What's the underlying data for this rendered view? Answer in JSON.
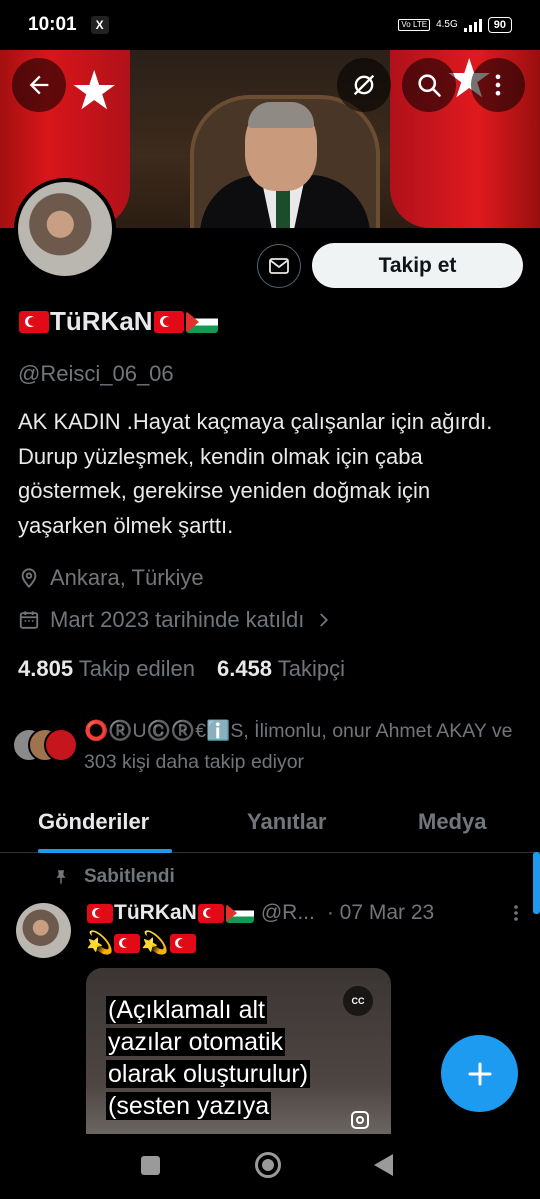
{
  "status_bar": {
    "time": "10:01",
    "notification": "X",
    "volte": "Vo LTE",
    "network": "4.5G",
    "battery": "90"
  },
  "header": {
    "back_icon": "arrow-left-icon",
    "hide_icon": "eye-slash-icon",
    "search_icon": "search-icon",
    "more_icon": "more-vertical-icon"
  },
  "profile": {
    "display_name": "TüRKaN",
    "handle": "@Reisci_06_06",
    "bio": "AK KADIN .Hayat kaçmaya çalışanlar için ağırdı. Durup yüzleşmek, kendin olmak için çaba göstermek, gerekirse yeniden doğmak için yaşarken ölmek şarttı.",
    "location": "Ankara, Türkiye",
    "joined": "Mart 2023 tarihinde katıldı",
    "following_count": "4.805",
    "following_label": "Takip edilen",
    "followers_count": "6.458",
    "followers_label": "Takipçi",
    "follow_button": "Takip et",
    "known_followers": "⭕®️U©️®️€ℹ️S, İlimonlu, onur Ahmet AKAY ve 303 kişi daha takip ediyor"
  },
  "tabs": [
    {
      "label": "Gönderiler",
      "active": true
    },
    {
      "label": "Yanıtlar",
      "active": false
    },
    {
      "label": "Medya",
      "active": false
    }
  ],
  "pinned_tweet": {
    "pinned_label": "Sabitlendi",
    "name": "TüRKaN",
    "handle": "@R...",
    "date": "· 07 Mar 23",
    "caption_lines": [
      "(Açıklamalı alt",
      "yazılar otomatik",
      "olarak oluşturulur)",
      "(sesten yazıya"
    ],
    "cc_label": "CC"
  },
  "colors": {
    "accent": "#1d9bf0",
    "background": "#000000",
    "text": "#e7e9ea",
    "muted": "#71767b"
  }
}
